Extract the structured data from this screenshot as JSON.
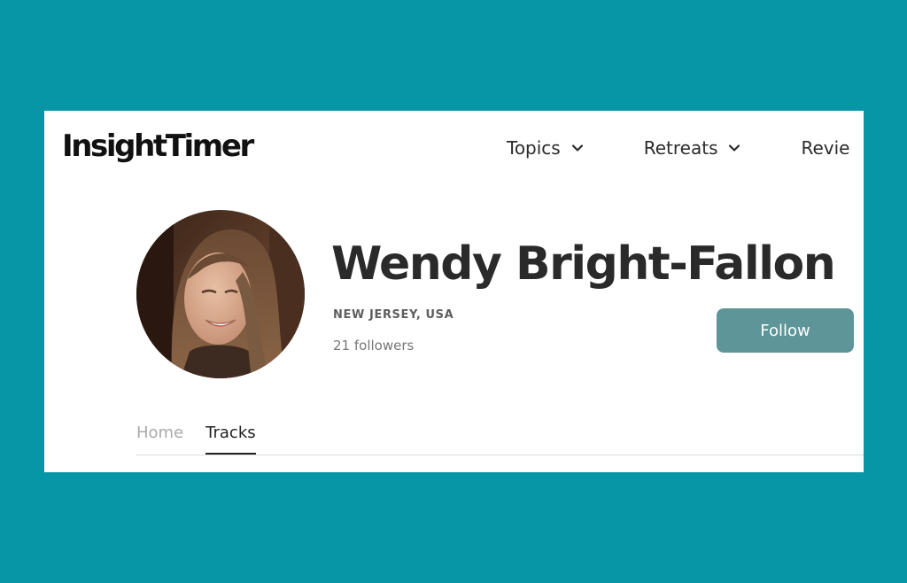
{
  "header": {
    "logo": "InsightTimer",
    "nav": [
      {
        "label": "Topics",
        "icon": "chevron-down-icon"
      },
      {
        "label": "Retreats",
        "icon": "chevron-down-icon"
      },
      {
        "label": "Revie"
      }
    ]
  },
  "profile": {
    "name": "Wendy Bright-Fallon",
    "location": "NEW JERSEY, USA",
    "followers": "21 followers",
    "follow_label": "Follow"
  },
  "tabs": [
    {
      "label": "Home",
      "active": false
    },
    {
      "label": "Tracks",
      "active": true
    }
  ],
  "colors": {
    "background": "#0796a6",
    "card": "#ffffff",
    "follow_button": "#5e9598",
    "text_dark": "#2a2a2a"
  }
}
